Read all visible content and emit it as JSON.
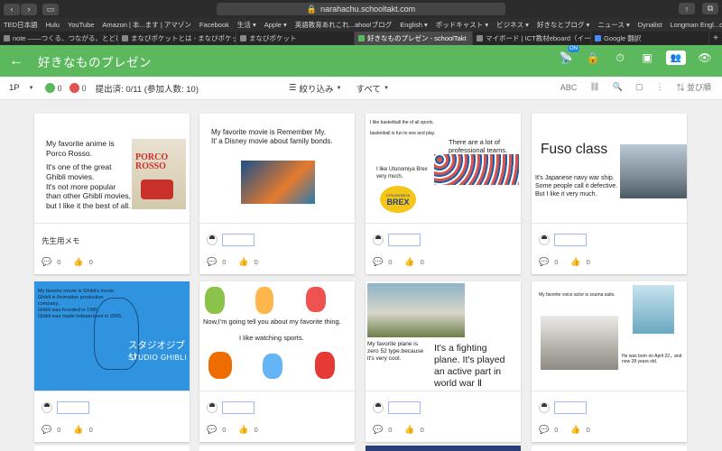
{
  "browser": {
    "url": "narahachu.schooltakt.com",
    "bookmarks": [
      "TED日本語",
      "Hulu",
      "YouTube",
      "Amazon | 本...ます | アマゾン",
      "Facebook",
      "生活 ▾",
      "Apple ▾",
      "英語教育あれこれ...ahoo!ブログ",
      "English ▾",
      "ポッドキャスト ▾",
      "ビジネス ▾",
      "好きなとブログ ▾",
      "ニュース ▾",
      "Dynalist",
      "Longman Engl...onary Online"
    ],
    "tabs": [
      {
        "label": "note ——つくる、つながる、とどける。",
        "active": false
      },
      {
        "label": "まなびポケットとは - まなびポケット | ...",
        "active": false
      },
      {
        "label": "まなびポケット",
        "active": false
      },
      {
        "label": "好きなものプレゼン - schoolTakt",
        "active": true
      },
      {
        "label": "マイボード | ICT教材eboard（イーボー...",
        "active": false
      },
      {
        "label": "Google 翻訳",
        "active": false
      }
    ]
  },
  "app": {
    "title": "好きなものプレゼン",
    "on_badge": "ON",
    "colors": {
      "header": "#5cb85c",
      "face_green": "#5cb85c",
      "face_red": "#e0544f",
      "name_box_border": "#9fb7ff"
    }
  },
  "toolbar": {
    "page": "1P",
    "green_count": "0",
    "red_count": "0",
    "submitted": "提出済: 0/11 (参加人数: 10)",
    "filter": "絞り込み",
    "filter_value": "すべて",
    "sort": "並び順"
  },
  "cards": [
    {
      "memo": "先生用メモ",
      "comments": "0",
      "likes": "0",
      "slide": {
        "lines": [
          "My favorite anime is",
          "Porco Rosso.",
          "It's one of the great",
          "Ghibli movies.",
          "It's not more popular",
          "than other Ghibli movies,",
          "but I like it the best of all."
        ],
        "poster": "PORCO ROSSO"
      }
    },
    {
      "comments": "0",
      "likes": "0",
      "slide": {
        "lines": [
          "My favorite movie is Remember My.",
          "It' a Disney movie about family bonds."
        ]
      }
    },
    {
      "comments": "0",
      "likes": "0",
      "slide": {
        "lines": [
          "I like basketball the of all sports.",
          "basketball is fun to see and play.",
          "There are a lot of",
          "professional teams.",
          "I like Utunomiya Brex",
          "very much."
        ],
        "logo": "BREX",
        "logo_sub": "UTSUNOMIYA"
      }
    },
    {
      "comments": "0",
      "likes": "0",
      "slide": {
        "title": "Fuso class",
        "lines": [
          "It's Japanese navy war ship.",
          "Some people call it defective.",
          "But I like it very much."
        ]
      }
    },
    {
      "comments": "0",
      "likes": "0",
      "slide": {
        "lines": [
          "My favorite movie is Ghibli's movie.",
          "Ghibli is Animation production",
          "company.",
          "Ghibli was founded in 1985.",
          "Ghibli was made independent in 2005."
        ],
        "logo_jp": "スタジオジブリ",
        "logo_en": "STUDIO GHIBLI"
      }
    },
    {
      "comments": "0",
      "likes": "0",
      "slide": {
        "lines": [
          "Now,I'm going tell you about my favorite thing.",
          "I  like watching sports."
        ]
      }
    },
    {
      "comments": "0",
      "likes": "0",
      "slide": {
        "lines": [
          "My favorite plane is",
          "zero 52 type.because",
          "it's very cool.",
          "It's a fighting",
          "plane. It's played",
          "an active part in",
          "world war  Ⅱ"
        ]
      }
    },
    {
      "comments": "0",
      "likes": "0",
      "slide": {
        "lines": [
          "My favorite voice actor is souma saito.",
          "He was born on April 22，and",
          "now 28 years old."
        ]
      }
    }
  ]
}
